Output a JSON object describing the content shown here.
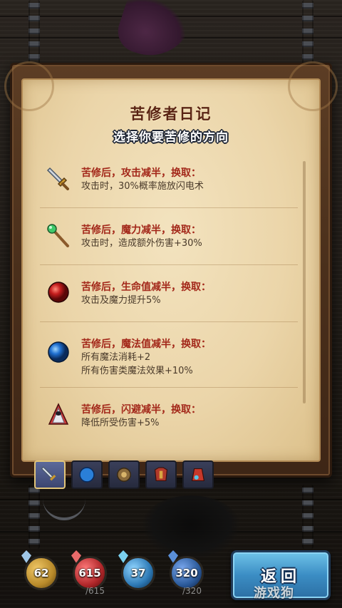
{
  "panel": {
    "title": "苦修者日记",
    "subtitle": "选择你要苦修的方向"
  },
  "options": [
    {
      "label": "苦修后，攻击减半，换取：",
      "lines": [
        "攻击时，30%概率施放闪电术"
      ],
      "icon": "sword-icon"
    },
    {
      "label": "苦修后，魔力减半，换取：",
      "lines": [
        "攻击时，造成额外伤害+30%"
      ],
      "icon": "staff-icon"
    },
    {
      "label": "苦修后，生命值减半，换取：",
      "lines": [
        "攻击及魔力提升5%"
      ],
      "icon": "red-orb-icon"
    },
    {
      "label": "苦修后，魔法值减半，换取：",
      "lines": [
        "所有魔法消耗+2",
        "所有伤害类魔法效果+10%"
      ],
      "icon": "blue-orb-icon"
    },
    {
      "label": "苦修后，闪避减半，换取：",
      "lines": [
        "降低所受伤害+5%"
      ],
      "icon": "hooded-figure-icon"
    }
  ],
  "tabs": [
    {
      "name": "tab-attack",
      "icon": "sword-icon",
      "active": true
    },
    {
      "name": "tab-mana-orb",
      "icon": "blue-orb-icon",
      "active": false
    },
    {
      "name": "tab-shield",
      "icon": "shield-icon",
      "active": false
    },
    {
      "name": "tab-armor",
      "icon": "armor-icon",
      "active": false
    },
    {
      "name": "tab-potion",
      "icon": "potion-icon",
      "active": false
    }
  ],
  "stats": [
    {
      "name": "attack",
      "value": "62",
      "max": "",
      "color": "#b88a2a"
    },
    {
      "name": "health",
      "value": "615",
      "max": "/615",
      "color": "#b0272a"
    },
    {
      "name": "magic",
      "value": "37",
      "max": "",
      "color": "#2d79b5"
    },
    {
      "name": "mana",
      "value": "320",
      "max": "/320",
      "color": "#2b5a9a"
    }
  ],
  "back_button": {
    "label": "返回"
  },
  "watermark": "游戏狗"
}
